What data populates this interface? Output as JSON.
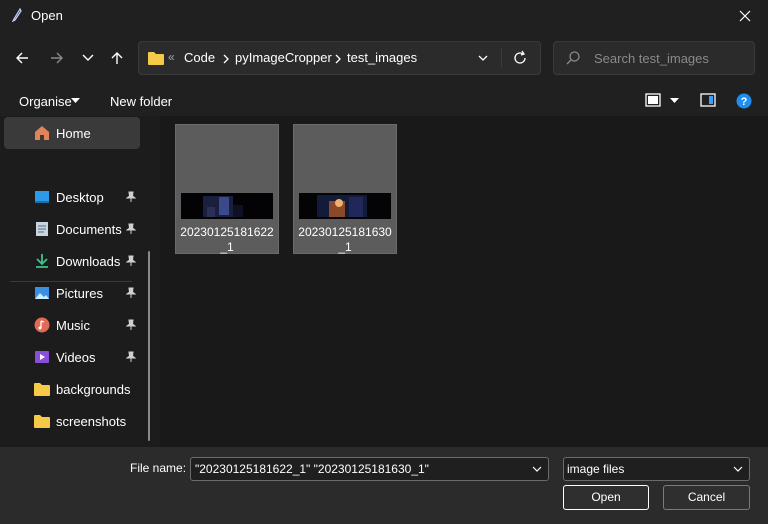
{
  "window": {
    "title": "Open"
  },
  "address": {
    "overflow_marker": "«",
    "crumbs": [
      "Code",
      "pyImageCropper",
      "test_images"
    ]
  },
  "search": {
    "placeholder": "Search test_images"
  },
  "commands": {
    "organise": "Organise",
    "new_folder": "New folder"
  },
  "sidebar": {
    "home": "Home",
    "items": [
      {
        "label": "Desktop",
        "icon": "desktop-icon",
        "pinned": true
      },
      {
        "label": "Documents",
        "icon": "documents-icon",
        "pinned": true
      },
      {
        "label": "Downloads",
        "icon": "downloads-icon",
        "pinned": true
      },
      {
        "label": "Pictures",
        "icon": "pictures-icon",
        "pinned": true
      },
      {
        "label": "Music",
        "icon": "music-icon",
        "pinned": true
      },
      {
        "label": "Videos",
        "icon": "videos-icon",
        "pinned": true
      },
      {
        "label": "backgrounds",
        "icon": "folder-icon",
        "pinned": false
      },
      {
        "label": "screenshots",
        "icon": "folder-icon",
        "pinned": false
      }
    ]
  },
  "files": [
    {
      "name": "20230125181622_1"
    },
    {
      "name": "20230125181630_1"
    }
  ],
  "footer": {
    "file_name_label": "File name:",
    "file_name_value": "\"20230125181622_1\" \"20230125181630_1\"",
    "file_type": "image files",
    "open_label": "Open",
    "cancel_label": "Cancel"
  },
  "colors": {
    "background": "#202020",
    "sidebar": "#1c1c1c",
    "content": "#191919",
    "selected_tile": "#5c5c5c",
    "folder": "#f7c948",
    "help": "#1f8ef1"
  }
}
